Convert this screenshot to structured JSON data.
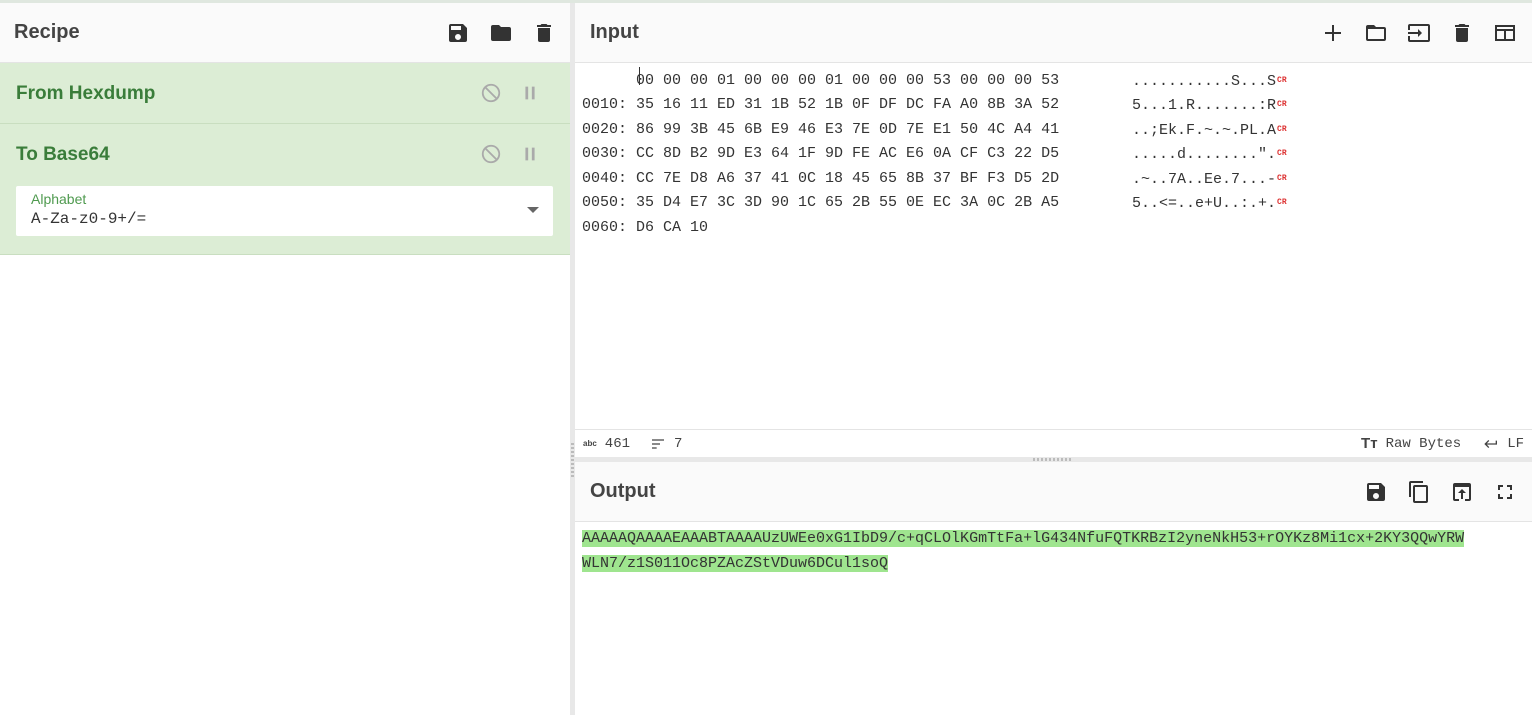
{
  "recipe": {
    "title": "Recipe",
    "operations": [
      {
        "name": "From Hexdump"
      },
      {
        "name": "To Base64",
        "arg_label": "Alphabet",
        "arg_value": "A-Za-z0-9+/="
      }
    ]
  },
  "input": {
    "title": "Input",
    "hex_lines": [
      "      00 00 00 01 00 00 00 01 00 00 00 53 00 00 00 53",
      "0010: 35 16 11 ED 31 1B 52 1B 0F DF DC FA A0 8B 3A 52",
      "0020: 86 99 3B 45 6B E9 46 E3 7E 0D 7E E1 50 4C A4 41",
      "0030: CC 8D B2 9D E3 64 1F 9D FE AC E6 0A CF C3 22 D5",
      "0040: CC 7E D8 A6 37 41 0C 18 45 65 8B 37 BF F3 D5 2D",
      "0050: 35 D4 E7 3C 3D 90 1C 65 2B 55 0E EC 3A 0C 2B A5",
      "0060: D6 CA 10"
    ],
    "ascii_lines": [
      "...........S...S",
      "5...1.R.......:R",
      "..;Ek.F.~.~.PL.A",
      ".....d........\".",
      ".~..7A..Ee.7...-",
      "5..<=..e+U..:.+."
    ],
    "cr_marker": "CR",
    "status": {
      "abc_icon": "abc",
      "length": "461",
      "lines": "7",
      "tt_icon": "Tт",
      "encoding": "Raw Bytes",
      "eol": "LF"
    }
  },
  "output": {
    "title": "Output",
    "lines": [
      "AAAAAQAAAAEAAABTAAAAUzUWEe0xG1IbD9/c+qCLOlKGmTtFa+lG434NfuFQTKRBzI2yneNkH53+rOYKz8Mi1cx+2KY3QQwYRW",
      "WLN7/z1S011Oc8PZAcZStVDuw6DCul1soQ"
    ]
  },
  "colors": {
    "op_background": "#dcedd5",
    "op_title": "#3a7d3a",
    "selection": "#9fe58f"
  }
}
